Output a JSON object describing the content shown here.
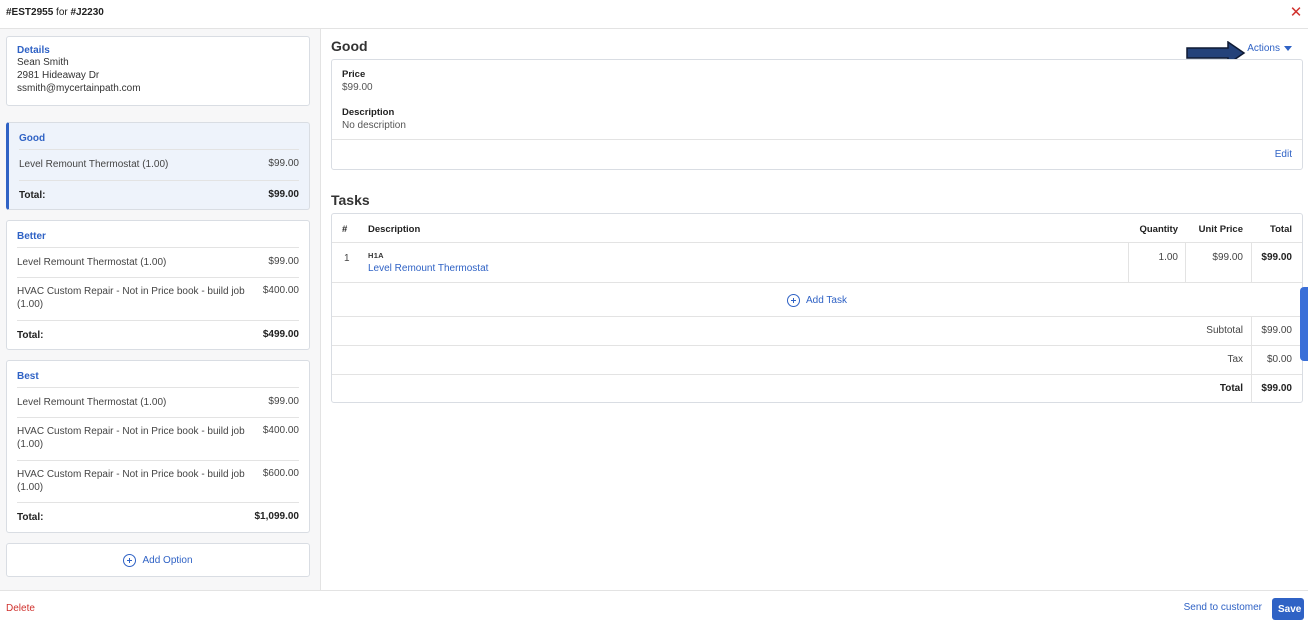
{
  "header": {
    "estimate_id": "#EST2955",
    "for_text": "for",
    "job_id": "#J2230",
    "close_symbol": "✕"
  },
  "details": {
    "label": "Details",
    "name": "Sean Smith",
    "address": "2981 Hideaway Dr",
    "email": "ssmith@mycertainpath.com"
  },
  "options": [
    {
      "name": "Good",
      "items": [
        {
          "desc": "Level Remount Thermostat (1.00)",
          "amount": "$99.00"
        }
      ],
      "total_label": "Total:",
      "total": "$99.00"
    },
    {
      "name": "Better",
      "items": [
        {
          "desc": "Level Remount Thermostat (1.00)",
          "amount": "$99.00"
        },
        {
          "desc": "HVAC Custom Repair - Not in Price book - build job (1.00)",
          "amount": "$400.00"
        }
      ],
      "total_label": "Total:",
      "total": "$499.00"
    },
    {
      "name": "Best",
      "items": [
        {
          "desc": "Level Remount Thermostat (1.00)",
          "amount": "$99.00"
        },
        {
          "desc": "HVAC Custom Repair - Not in Price book - build job (1.00)",
          "amount": "$400.00"
        },
        {
          "desc": "HVAC Custom Repair - Not in Price book - build job (1.00)",
          "amount": "$600.00"
        }
      ],
      "total_label": "Total:",
      "total": "$1,099.00"
    }
  ],
  "add_option_label": "Add Option",
  "main": {
    "title": "Good",
    "actions_label": "Actions",
    "price_label": "Price",
    "price_value": "$99.00",
    "description_label": "Description",
    "description_value": "No description",
    "edit_label": "Edit"
  },
  "tasks": {
    "title": "Tasks",
    "columns": {
      "num": "#",
      "description": "Description",
      "quantity": "Quantity",
      "unit_price": "Unit Price",
      "total": "Total"
    },
    "rows": [
      {
        "num": "1",
        "code": "H1A",
        "name": "Level Remount Thermostat",
        "quantity": "1.00",
        "unit_price": "$99.00",
        "total": "$99.00"
      }
    ],
    "add_task_label": "Add Task",
    "subtotal_label": "Subtotal",
    "subtotal_value": "$99.00",
    "tax_label": "Tax",
    "tax_value": "$0.00",
    "total_label": "Total",
    "total_value": "$99.00"
  },
  "footer": {
    "delete_label": "Delete",
    "send_label": "Send to customer",
    "save_label": "Save"
  },
  "colors": {
    "accent": "#2f62c5",
    "danger": "#d0312d",
    "arrow_fill": "#24427a"
  }
}
